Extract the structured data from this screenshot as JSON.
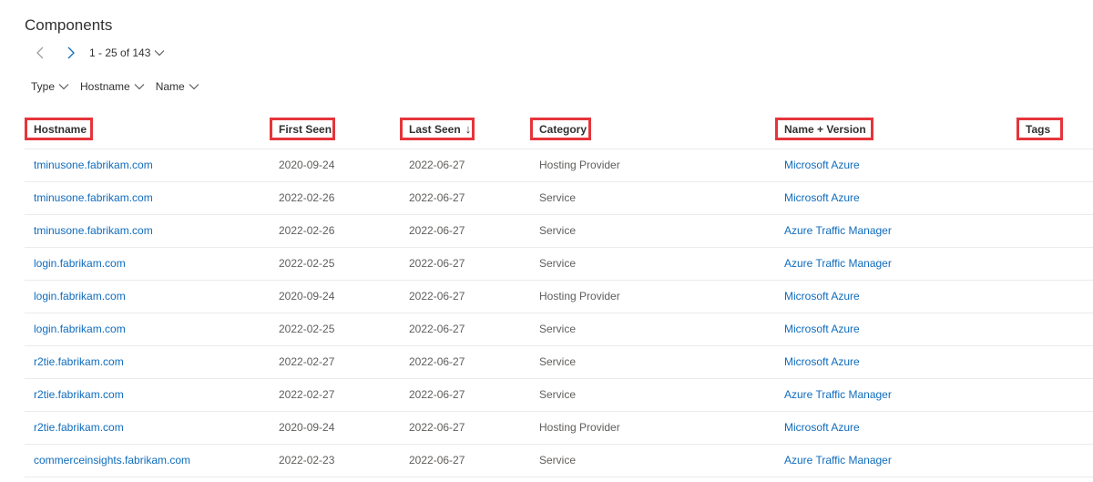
{
  "page": {
    "title": "Components"
  },
  "pager": {
    "range": "1 - 25 of 143"
  },
  "filters": [
    {
      "label": "Type"
    },
    {
      "label": "Hostname"
    },
    {
      "label": "Name"
    }
  ],
  "columns": {
    "hostname": "Hostname",
    "first_seen": "First Seen",
    "last_seen": "Last Seen",
    "last_seen_sort": "↓",
    "category": "Category",
    "name_version": "Name + Version",
    "tags": "Tags"
  },
  "rows": [
    {
      "hostname": "tminusone.fabrikam.com",
      "first_seen": "2020-09-24",
      "last_seen": "2022-06-27",
      "category": "Hosting Provider",
      "name_version": "Microsoft Azure"
    },
    {
      "hostname": "tminusone.fabrikam.com",
      "first_seen": "2022-02-26",
      "last_seen": "2022-06-27",
      "category": "Service",
      "name_version": "Microsoft Azure"
    },
    {
      "hostname": "tminusone.fabrikam.com",
      "first_seen": "2022-02-26",
      "last_seen": "2022-06-27",
      "category": "Service",
      "name_version": "Azure Traffic Manager"
    },
    {
      "hostname": "login.fabrikam.com",
      "first_seen": "2022-02-25",
      "last_seen": "2022-06-27",
      "category": "Service",
      "name_version": "Azure Traffic Manager"
    },
    {
      "hostname": "login.fabrikam.com",
      "first_seen": "2020-09-24",
      "last_seen": "2022-06-27",
      "category": "Hosting Provider",
      "name_version": "Microsoft Azure"
    },
    {
      "hostname": "login.fabrikam.com",
      "first_seen": "2022-02-25",
      "last_seen": "2022-06-27",
      "category": "Service",
      "name_version": "Microsoft Azure"
    },
    {
      "hostname": "r2tie.fabrikam.com",
      "first_seen": "2022-02-27",
      "last_seen": "2022-06-27",
      "category": "Service",
      "name_version": "Microsoft Azure"
    },
    {
      "hostname": "r2tie.fabrikam.com",
      "first_seen": "2022-02-27",
      "last_seen": "2022-06-27",
      "category": "Service",
      "name_version": "Azure Traffic Manager"
    },
    {
      "hostname": "r2tie.fabrikam.com",
      "first_seen": "2020-09-24",
      "last_seen": "2022-06-27",
      "category": "Hosting Provider",
      "name_version": "Microsoft Azure"
    },
    {
      "hostname": "commerceinsights.fabrikam.com",
      "first_seen": "2022-02-23",
      "last_seen": "2022-06-27",
      "category": "Service",
      "name_version": "Azure Traffic Manager"
    }
  ],
  "colors": {
    "link": "#0f6cbd",
    "highlight_border": "#e5353b",
    "row_divider": "#edebe9"
  },
  "icons": {
    "prev": "chevron-left-icon",
    "next": "chevron-right-icon",
    "dropdown": "chevron-down-icon"
  }
}
